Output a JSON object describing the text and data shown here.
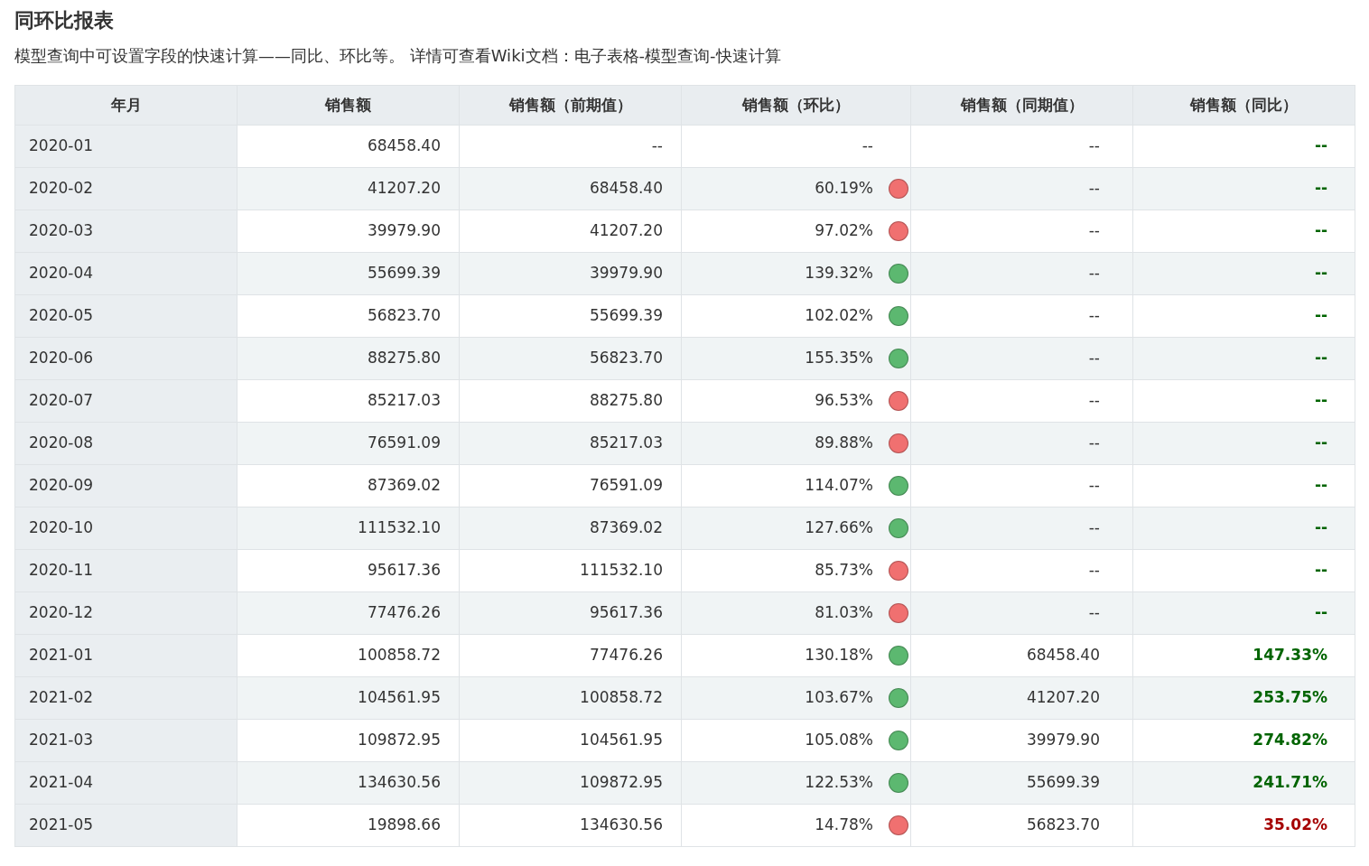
{
  "title": "同环比报表",
  "description": "模型查询中可设置字段的快速计算——同比、环比等。 详情可查看Wiki文档：电子表格-模型查询-快速计算",
  "table": {
    "columns": [
      "年月",
      "销售额",
      "销售额（前期值）",
      "销售额（环比）",
      "销售额（同期值）",
      "销售额（同比）"
    ],
    "rows": [
      {
        "month": "2020-01",
        "sales": "68458.40",
        "prev": "--",
        "mom": {
          "text": "--"
        },
        "same_period": "--",
        "yoy": {
          "text": "--",
          "color": "#006400"
        }
      },
      {
        "month": "2020-02",
        "sales": "41207.20",
        "prev": "68458.40",
        "mom": {
          "text": "60.19%",
          "color": "#f07070"
        },
        "same_period": "--",
        "yoy": {
          "text": "--",
          "color": "#006400"
        }
      },
      {
        "month": "2020-03",
        "sales": "39979.90",
        "prev": "41207.20",
        "mom": {
          "text": "97.02%",
          "color": "#f07070"
        },
        "same_period": "--",
        "yoy": {
          "text": "--",
          "color": "#006400"
        }
      },
      {
        "month": "2020-04",
        "sales": "55699.39",
        "prev": "39979.90",
        "mom": {
          "text": "139.32%",
          "color": "#5cb870"
        },
        "same_period": "--",
        "yoy": {
          "text": "--",
          "color": "#006400"
        }
      },
      {
        "month": "2020-05",
        "sales": "56823.70",
        "prev": "55699.39",
        "mom": {
          "text": "102.02%",
          "color": "#5cb870"
        },
        "same_period": "--",
        "yoy": {
          "text": "--",
          "color": "#006400"
        }
      },
      {
        "month": "2020-06",
        "sales": "88275.80",
        "prev": "56823.70",
        "mom": {
          "text": "155.35%",
          "color": "#5cb870"
        },
        "same_period": "--",
        "yoy": {
          "text": "--",
          "color": "#006400"
        }
      },
      {
        "month": "2020-07",
        "sales": "85217.03",
        "prev": "88275.80",
        "mom": {
          "text": "96.53%",
          "color": "#f07070"
        },
        "same_period": "--",
        "yoy": {
          "text": "--",
          "color": "#006400"
        }
      },
      {
        "month": "2020-08",
        "sales": "76591.09",
        "prev": "85217.03",
        "mom": {
          "text": "89.88%",
          "color": "#f07070"
        },
        "same_period": "--",
        "yoy": {
          "text": "--",
          "color": "#006400"
        }
      },
      {
        "month": "2020-09",
        "sales": "87369.02",
        "prev": "76591.09",
        "mom": {
          "text": "114.07%",
          "color": "#5cb870"
        },
        "same_period": "--",
        "yoy": {
          "text": "--",
          "color": "#006400"
        }
      },
      {
        "month": "2020-10",
        "sales": "111532.10",
        "prev": "87369.02",
        "mom": {
          "text": "127.66%",
          "color": "#5cb870"
        },
        "same_period": "--",
        "yoy": {
          "text": "--",
          "color": "#006400"
        }
      },
      {
        "month": "2020-11",
        "sales": "95617.36",
        "prev": "111532.10",
        "mom": {
          "text": "85.73%",
          "color": "#f07070"
        },
        "same_period": "--",
        "yoy": {
          "text": "--",
          "color": "#006400"
        }
      },
      {
        "month": "2020-12",
        "sales": "77476.26",
        "prev": "95617.36",
        "mom": {
          "text": "81.03%",
          "color": "#f07070"
        },
        "same_period": "--",
        "yoy": {
          "text": "--",
          "color": "#006400"
        }
      },
      {
        "month": "2021-01",
        "sales": "100858.72",
        "prev": "77476.26",
        "mom": {
          "text": "130.18%",
          "color": "#5cb870"
        },
        "same_period": "68458.40",
        "yoy": {
          "text": "147.33%",
          "color": "#006400"
        }
      },
      {
        "month": "2021-02",
        "sales": "104561.95",
        "prev": "100858.72",
        "mom": {
          "text": "103.67%",
          "color": "#5cb870"
        },
        "same_period": "41207.20",
        "yoy": {
          "text": "253.75%",
          "color": "#006400"
        }
      },
      {
        "month": "2021-03",
        "sales": "109872.95",
        "prev": "104561.95",
        "mom": {
          "text": "105.08%",
          "color": "#5cb870"
        },
        "same_period": "39979.90",
        "yoy": {
          "text": "274.82%",
          "color": "#006400"
        }
      },
      {
        "month": "2021-04",
        "sales": "134630.56",
        "prev": "109872.95",
        "mom": {
          "text": "122.53%",
          "color": "#5cb870"
        },
        "same_period": "55699.39",
        "yoy": {
          "text": "241.71%",
          "color": "#006400"
        }
      },
      {
        "month": "2021-05",
        "sales": "19898.66",
        "prev": "134630.56",
        "mom": {
          "text": "14.78%",
          "color": "#f07070"
        },
        "same_period": "56823.70",
        "yoy": {
          "text": "35.02%",
          "color": "#a50000"
        }
      }
    ]
  }
}
